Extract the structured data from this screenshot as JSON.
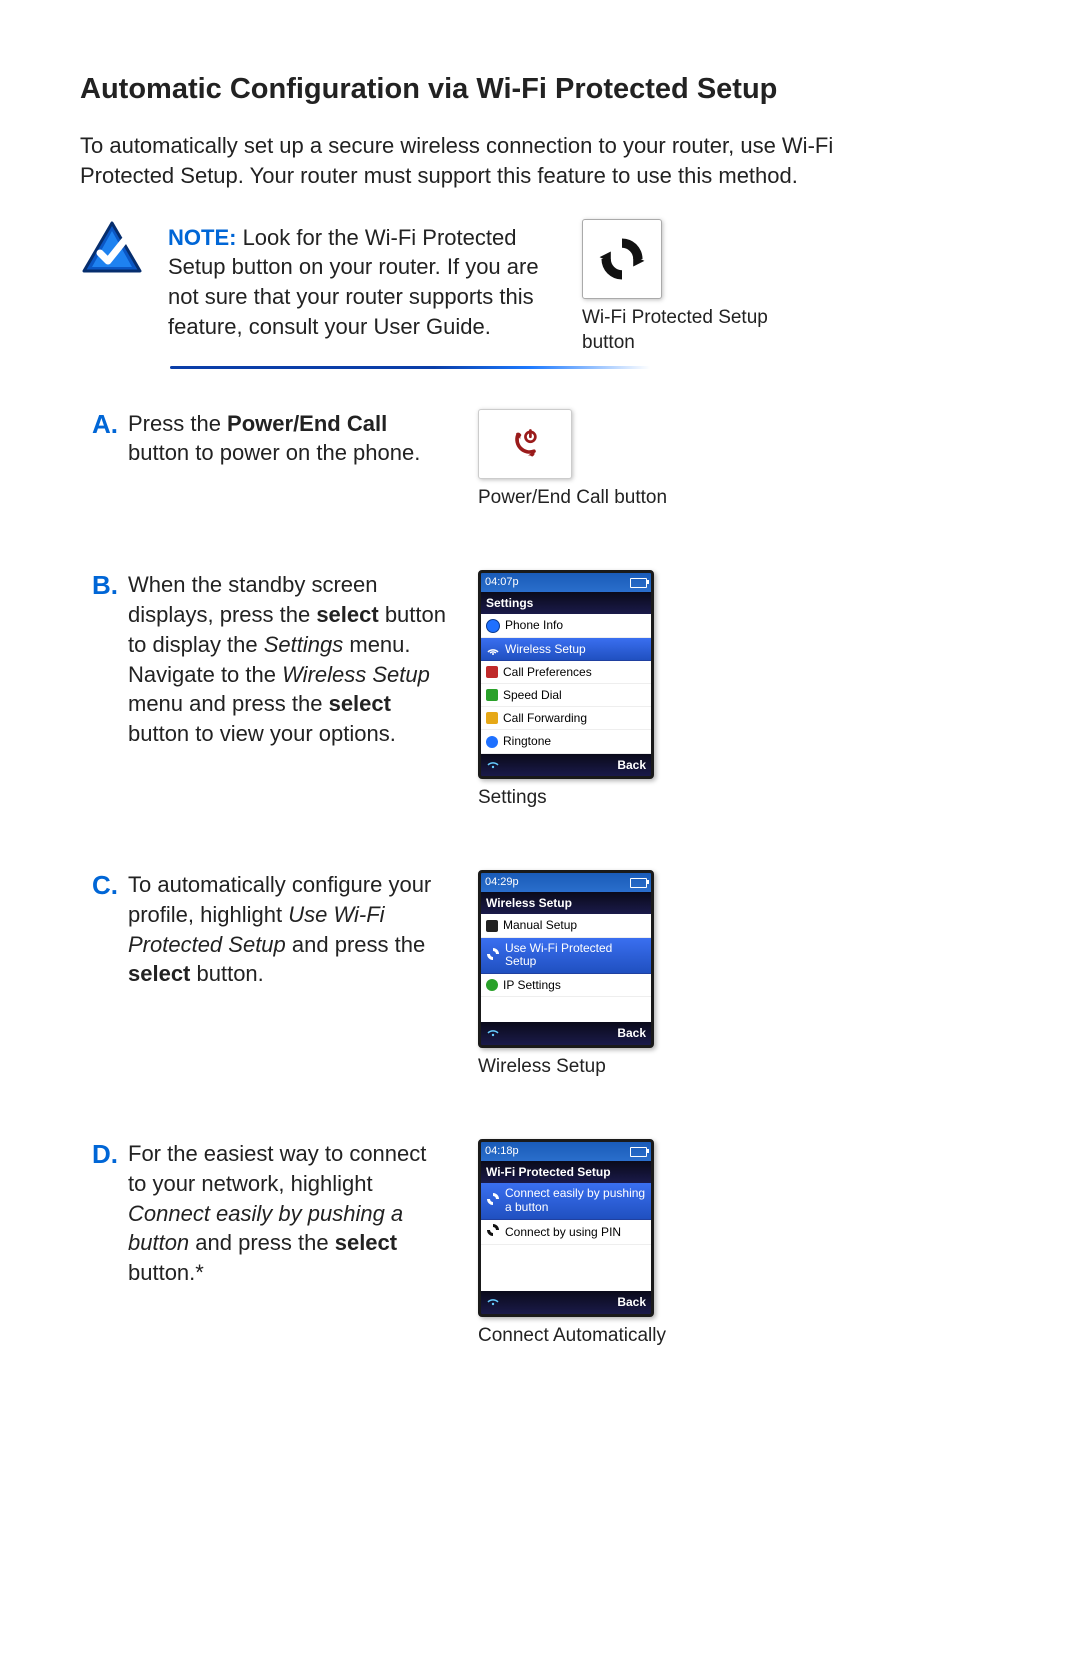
{
  "heading": "Automatic Configuration via Wi-Fi Protected Setup",
  "intro": "To automatically set up a secure wireless connection to your router, use Wi-Fi Protected Setup.  Your router must support this feature to use this method.",
  "note": {
    "label": "NOTE:",
    "text": " Look for the Wi-Fi Protected Setup button on your router.  If  you are not sure that your router supports this feature, consult your User Guide."
  },
  "wpsCaption": "Wi-Fi Protected Setup button",
  "steps": {
    "A": {
      "letter": "A.",
      "pre": "Press the ",
      "bold1": "Power/End Call",
      "post": " button to power on the phone.",
      "figCaption": "Power/End Call button"
    },
    "B": {
      "letter": "B.",
      "t1": "When the standby screen displays, press the ",
      "b1": "select",
      "t2": " button to display the ",
      "i1": "Settings",
      "t3": " menu. Navigate to the ",
      "i2": "Wireless Setup",
      "t4": " menu and press the ",
      "b2": "select",
      "t5": " button to view your options.",
      "figCaption": "Settings",
      "phone": {
        "time": "04:07p",
        "title": "Settings",
        "items": [
          {
            "label": "Phone Info"
          },
          {
            "label": "Wireless Setup",
            "selected": true
          },
          {
            "label": "Call Preferences"
          },
          {
            "label": "Speed Dial"
          },
          {
            "label": "Call Forwarding"
          },
          {
            "label": "Ringtone"
          }
        ],
        "soft": "Back"
      }
    },
    "C": {
      "letter": "C.",
      "t1": "To automatically configure your profile, highlight ",
      "i1": "Use Wi-Fi Protected Setup",
      "t2": " and press the ",
      "b1": "select",
      "t3": " button.",
      "figCaption": "Wireless Setup",
      "phone": {
        "time": "04:29p",
        "title": "Wireless Setup",
        "items": [
          {
            "label": "Manual Setup"
          },
          {
            "label": "Use Wi-Fi Protected Setup",
            "selected": true
          },
          {
            "label": "IP Settings"
          }
        ],
        "soft": "Back"
      }
    },
    "D": {
      "letter": "D.",
      "t1": "For the easiest way to connect to your network, highlight ",
      "i1": "Connect easily by pushing a button",
      "t2": "  and press the ",
      "b1": "select",
      "t3": " button.*",
      "figCaption": "Connect Automatically",
      "phone": {
        "time": "04:18p",
        "title": "Wi-Fi Protected Setup",
        "items": [
          {
            "label": "Connect easily by pushing a button",
            "selected": true
          },
          {
            "label": "Connect by using PIN"
          }
        ],
        "soft": "Back"
      }
    }
  }
}
